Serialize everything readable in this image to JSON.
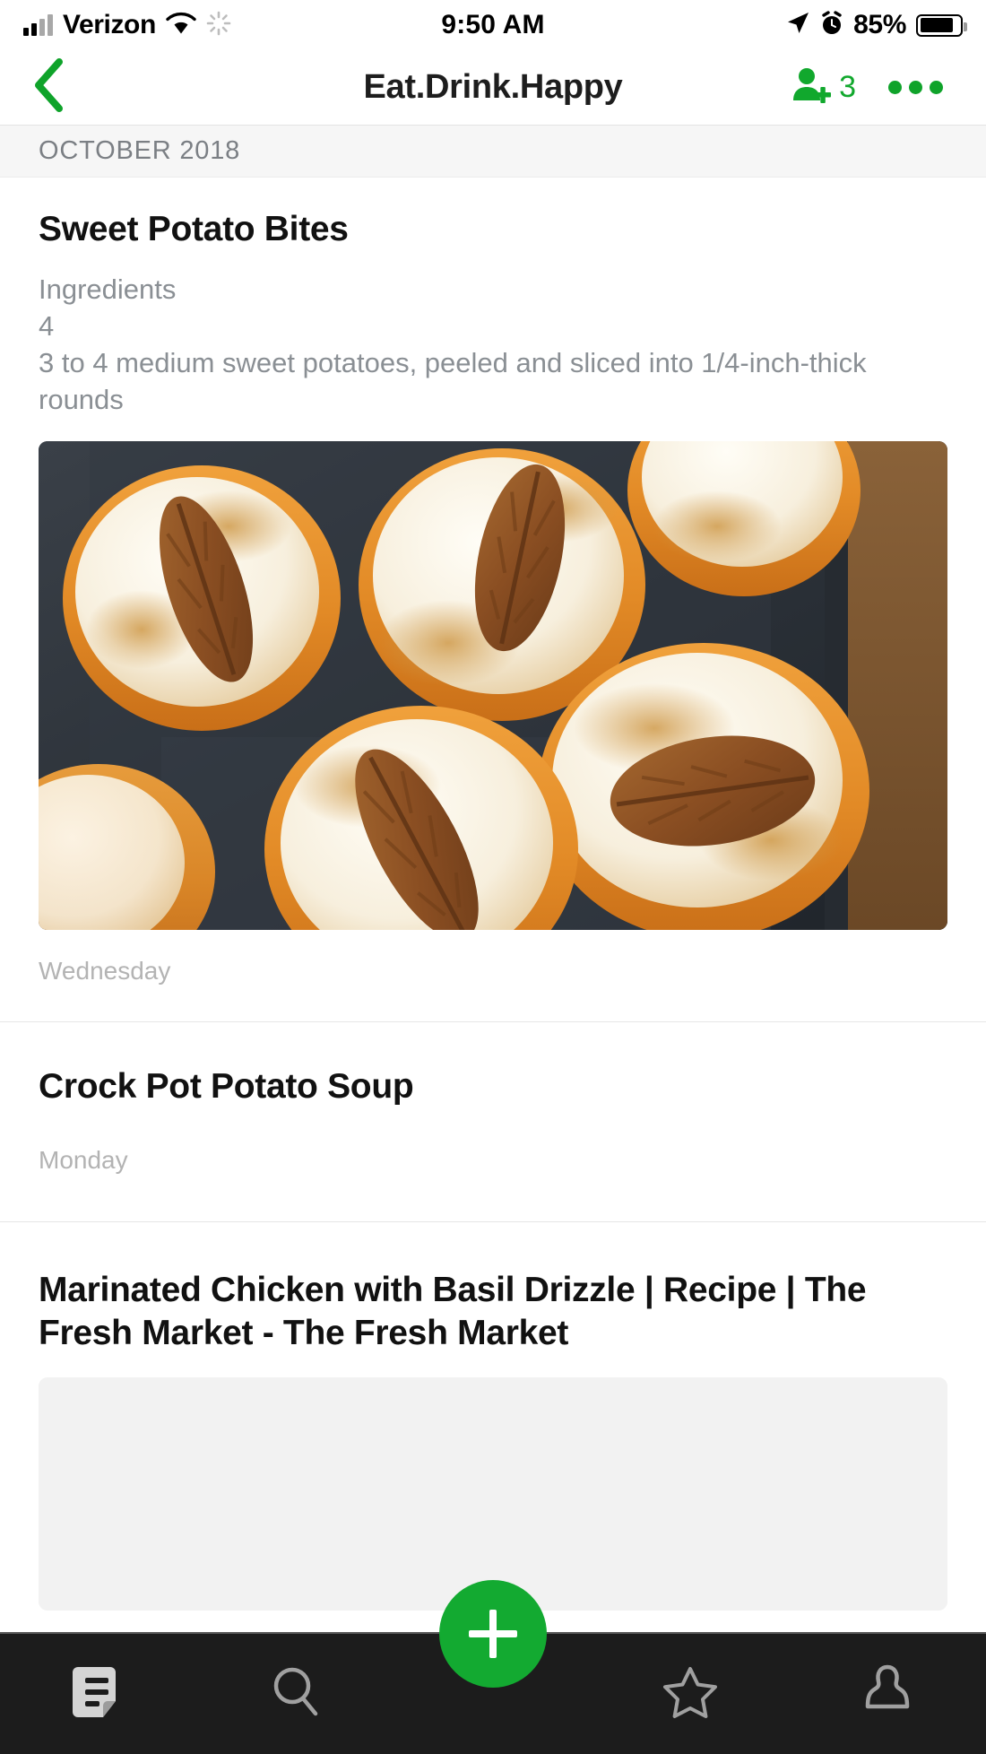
{
  "status_bar": {
    "carrier": "Verizon",
    "time": "9:50 AM",
    "battery_percent": "85%",
    "icons": {
      "signal": "signal-bars-icon",
      "wifi": "wifi-icon",
      "spinner": "activity-spinner-icon",
      "location": "location-arrow-icon",
      "alarm": "alarm-clock-icon",
      "battery": "battery-icon"
    }
  },
  "navbar": {
    "back_icon": "back-chevron-icon",
    "title": "Eat.Drink.Happy",
    "share_icon": "add-person-icon",
    "share_count": "3",
    "more_icon": "more-options-icon"
  },
  "section": {
    "header": "OCTOBER 2018"
  },
  "feed": {
    "items": [
      {
        "title": "Sweet Potato Bites",
        "body_lines": [
          "Ingredients",
          "4",
          "3 to 4 medium sweet potatoes, peeled and sliced into 1/4-inch-thick rounds"
        ],
        "has_photo": true,
        "photo_alt": "sweet-potato-bites-photo",
        "time": "Wednesday"
      },
      {
        "title": "Crock Pot Potato Soup",
        "body_lines": [],
        "has_photo": false,
        "time": "Monday"
      },
      {
        "title": "Marinated Chicken with Basil Drizzle | Recipe | The Fresh Market - The Fresh Market",
        "body_lines": [],
        "has_photo": false,
        "has_placeholder": true,
        "time": ""
      }
    ]
  },
  "tabbar": {
    "items": [
      {
        "name": "notes-tab",
        "icon": "notes-icon",
        "active": true
      },
      {
        "name": "search-tab",
        "icon": "search-icon",
        "active": false
      },
      {
        "name": "add-tab",
        "icon": "plus-icon",
        "active": false
      },
      {
        "name": "favorites-tab",
        "icon": "star-icon",
        "active": false
      },
      {
        "name": "profile-tab",
        "icon": "person-icon",
        "active": false
      }
    ]
  },
  "colors": {
    "brand_green": "#13aa31",
    "nav_green": "#0fa32a",
    "tabbar_bg": "#1c1c1c",
    "section_bg": "#f6f6f6",
    "body_text": "#8a8f94",
    "time_text": "#b3b3b3"
  }
}
